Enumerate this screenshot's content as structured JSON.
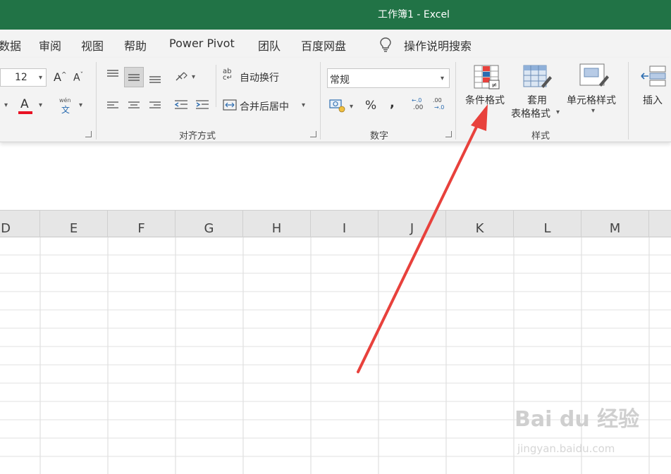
{
  "window": {
    "title": "工作簿1  -  Excel"
  },
  "menu": [
    {
      "label": "数据",
      "name": "menu-data"
    },
    {
      "label": "审阅",
      "name": "menu-review"
    },
    {
      "label": "视图",
      "name": "menu-view"
    },
    {
      "label": "帮助",
      "name": "menu-help"
    },
    {
      "label": "Power Pivot",
      "name": "menu-power-pivot"
    },
    {
      "label": "团队",
      "name": "menu-team"
    },
    {
      "label": "百度网盘",
      "name": "menu-baidu-pan"
    }
  ],
  "tell_me": {
    "label": "操作说明搜索"
  },
  "ribbon": {
    "font": {
      "size": "12"
    },
    "alignment": {
      "wrap_text": "自动换行",
      "merge_center": "合并后居中",
      "group_label": "对齐方式"
    },
    "number": {
      "format": "常规",
      "percent": "%",
      "comma": ",",
      "increase_decimal": ".00",
      "decrease_decimal": ".00",
      "group_label": "数字"
    },
    "styles": {
      "conditional_formatting": "条件格式",
      "format_as_table_line1": "套用",
      "format_as_table_line2": "表格格式",
      "cell_styles": "单元格样式",
      "group_label": "样式"
    },
    "cells": {
      "insert": "插入"
    }
  },
  "columns": [
    "D",
    "E",
    "F",
    "G",
    "H",
    "I",
    "J",
    "K",
    "L",
    "M"
  ],
  "watermark": {
    "brand": "Bai du 经验",
    "url": "jingyan.baidu.com"
  },
  "colors": {
    "title_bar": "#217346",
    "arrow": "#e8413c",
    "font_color": "#e81123"
  }
}
